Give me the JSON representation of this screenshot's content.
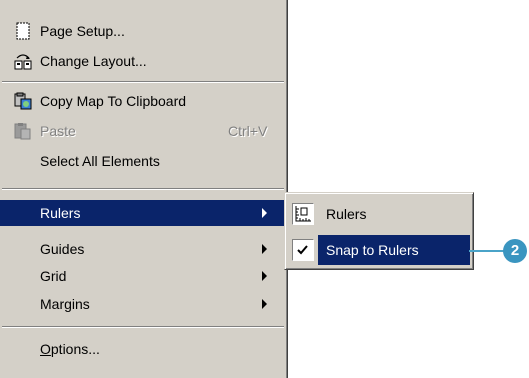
{
  "menu": {
    "items": [
      {
        "label": "Page Setup...",
        "icon": "page-setup-icon"
      },
      {
        "label": "Change Layout...",
        "icon": "change-layout-icon"
      },
      {
        "label": "Copy Map To Clipboard",
        "icon": "copy-map-icon"
      },
      {
        "label": "Paste",
        "shortcut": "Ctrl+V",
        "icon": "paste-icon",
        "disabled": true
      },
      {
        "label": "Select All Elements"
      },
      {
        "label": "Rulers",
        "submenu": true,
        "selected": true
      },
      {
        "label": "Guides",
        "submenu": true
      },
      {
        "label": "Grid",
        "submenu": true
      },
      {
        "label": "Margins",
        "submenu": true
      },
      {
        "label": "Options..."
      }
    ]
  },
  "submenu": {
    "items": [
      {
        "label": "Rulers",
        "icon": "rulers-icon"
      },
      {
        "label": "Snap to Rulers",
        "icon": "checkmark-icon",
        "checked": true,
        "selected": true
      }
    ]
  },
  "callout": {
    "number": "2"
  },
  "colors": {
    "selection": "#0a246a",
    "menu_bg": "#d4d0c8",
    "callout": "#3a95c0"
  }
}
